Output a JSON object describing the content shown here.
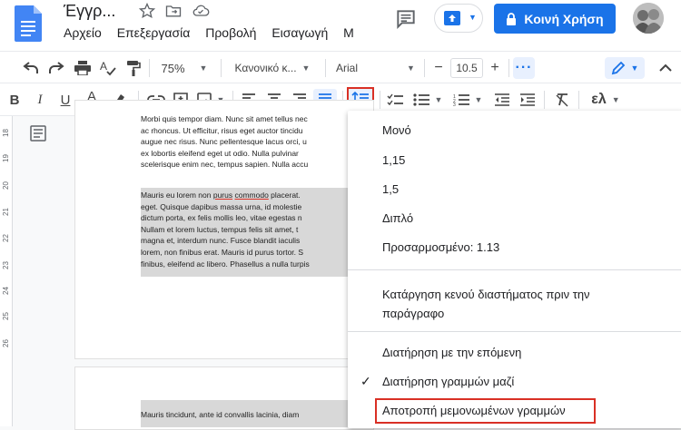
{
  "header": {
    "doc_title": "Έγγρ...",
    "menu": [
      "Αρχείο",
      "Επεξεργασία",
      "Προβολή",
      "Εισαγωγή",
      "Μ"
    ],
    "share_label": "Κοινή Χρήση"
  },
  "toolbar": {
    "zoom": "75%",
    "style": "Κανονικό κ...",
    "font": "Arial",
    "font_size": "10.5",
    "minus": "−",
    "plus": "+",
    "bold": "B",
    "italic": "I",
    "underline": "U",
    "text_color": "A",
    "input_tools": "ελ"
  },
  "ruler": {
    "numbers": [
      "18",
      "19",
      "20",
      "21",
      "22",
      "23",
      "24",
      "25",
      "26"
    ]
  },
  "document": {
    "para1": [
      "Morbi quis tempor diam. Nunc sit amet tellus nec",
      "ac rhoncus. Ut efficitur, risus eget auctor tincidu",
      "augue nec risus. Nunc pellentesque lacus orci, u",
      "ex lobortis eleifend eget ut odio. Nulla pulvinar",
      "scelerisque enim nec, tempus sapien. Nulla  accu"
    ],
    "para2_first_pre": "Mauris eu lorem non ",
    "para2_first_u1": "purus",
    "para2_first_mid": " ",
    "para2_first_u2": "commodo",
    "para2_first_post": " placerat.",
    "para2_rest": [
      "eget. Quisque dapibus massa urna, id molestie",
      "dictum porta, ex felis mollis leo, vitae egestas n",
      "Nullam et lorem luctus, tempus felis sit amet, t",
      "magna et, interdum nunc. Fusce blandit iaculis",
      "lorem, non finibus erat. Mauris id purus tortor. S",
      "finibus, eleifend ac libero. Phasellus a nulla turpis"
    ],
    "para3": "Mauris tincidunt, ante  id convallis lacinia, diam"
  },
  "line_spacing_menu": {
    "single": "Μονό",
    "s115": "1,15",
    "s15": "1,5",
    "double": "Διπλό",
    "custom": "Προσαρμοσμένο: 1.13",
    "remove_space_line1": "Κατάργηση κενού διαστήματος πριν την",
    "remove_space_line2": "παράγραφο",
    "keep_with_next": "Διατήρηση με την επόμενη",
    "keep_lines_together": "Διατήρηση γραμμών μαζί",
    "prevent_orphan": "Αποτροπή μεμονωμένων γραμμών",
    "checkmark": "✓"
  },
  "colors": {
    "accent": "#1a73e8",
    "highlight_box": "#d93025"
  }
}
